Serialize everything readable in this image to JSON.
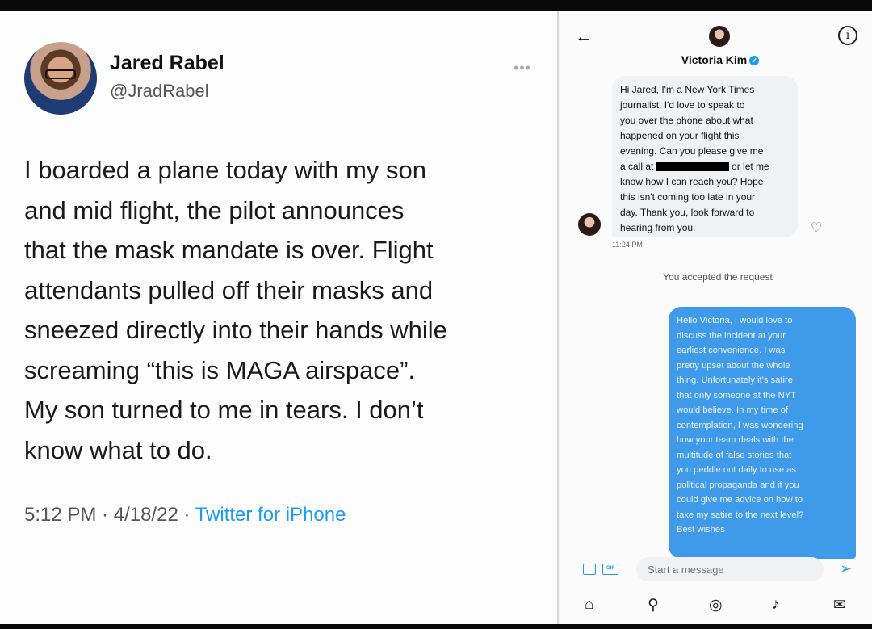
{
  "tweet": {
    "author_name": "Jared Rabel",
    "author_handle": "@JradRabel",
    "more_icon": "ellipsis-icon",
    "text": "I boarded a plane today with my son\nand mid flight, the pilot announces\nthat the mask mandate is over. Flight\nattendants pulled off their masks and\nsneezed directly into their hands while\nscreaming “this is MAGA airspace”.\nMy son turned to me in tears. I don’t\nknow what to do.",
    "time": "5:12 PM",
    "date": "4/18/22",
    "source": "Twitter for iPhone",
    "separator": " · "
  },
  "dm": {
    "back_icon": "←",
    "contact_name": "Victoria Kim",
    "verified_icon": "✓",
    "info_icon": "i",
    "incoming_part1": "Hi Jared, I'm a New York Times\njournalist, I'd love to speak to\nyou over the phone about what\nhappened on your flight this\nevening. Can you please give me\na call at ",
    "incoming_part2": " or let me\nknow how I can reach you? Hope\nthis isn't coming too late in your\nday. Thank you, look forward to\nhearing from you.",
    "incoming_time": "11:24 PM",
    "system_message": "You accepted the request",
    "outgoing": "Hello Victoria, I would love to\ndiscuss the incident at your\nearliest convenience. I was\npretty upset about the whole\nthing. Unfortunately it's satire\nthat only someone at the NYT\nwould believe. In my time of\ncontemplation, I was wondering\nhow your team deals with the\nmultitude of false stories that\nyou peddle out daily to use as\npolitical propaganda and if you\ncould give me advice on how to\ntake my satire to the next level?\nBest wishes",
    "composer_placeholder": "Start a message",
    "gif_label": "GIF",
    "react_icon": "♡",
    "send_icon": "➢",
    "tabs": [
      "⌂",
      "⚲",
      "◎",
      "♪",
      "✉"
    ]
  },
  "colors": {
    "accent": "#1d9bf0",
    "outgoing_bubble": "#3f9be9",
    "incoming_bubble": "#eff1f3"
  }
}
